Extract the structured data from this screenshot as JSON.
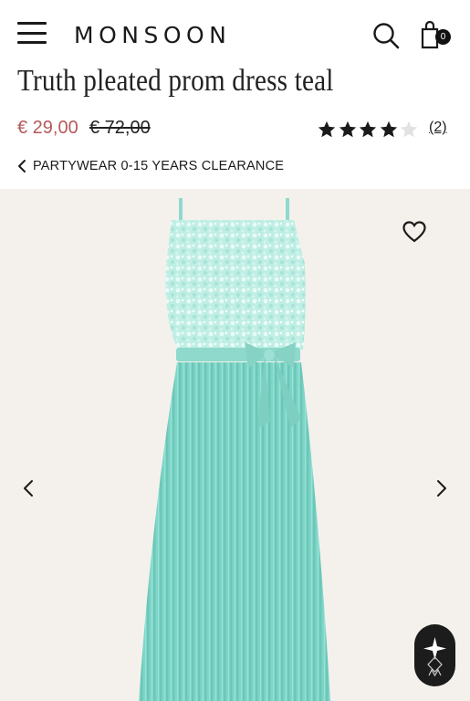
{
  "header": {
    "brand": "MONSOON",
    "bag_count": "0",
    "icons": [
      "hamburger-menu-icon",
      "search-icon",
      "shopping-bag-icon"
    ]
  },
  "product": {
    "title": "Truth pleated prom dress teal",
    "price_sale": "€ 29,00",
    "price_original": "€ 72,00",
    "rating_value": 4,
    "rating_max": 5,
    "review_count": "(2)"
  },
  "breadcrumb": {
    "label": "PARTYWEAR 0-15 YEARS CLEARANCE"
  },
  "gallery": {
    "icons": [
      "heart-icon",
      "chevron-left-icon",
      "chevron-right-icon",
      "assistant-icon"
    ]
  },
  "colors": {
    "sale": "#b4595b",
    "text": "#1a1a1a",
    "gallery_bg": "#f4f1ec",
    "dress_teal": "#7fd6c8"
  }
}
